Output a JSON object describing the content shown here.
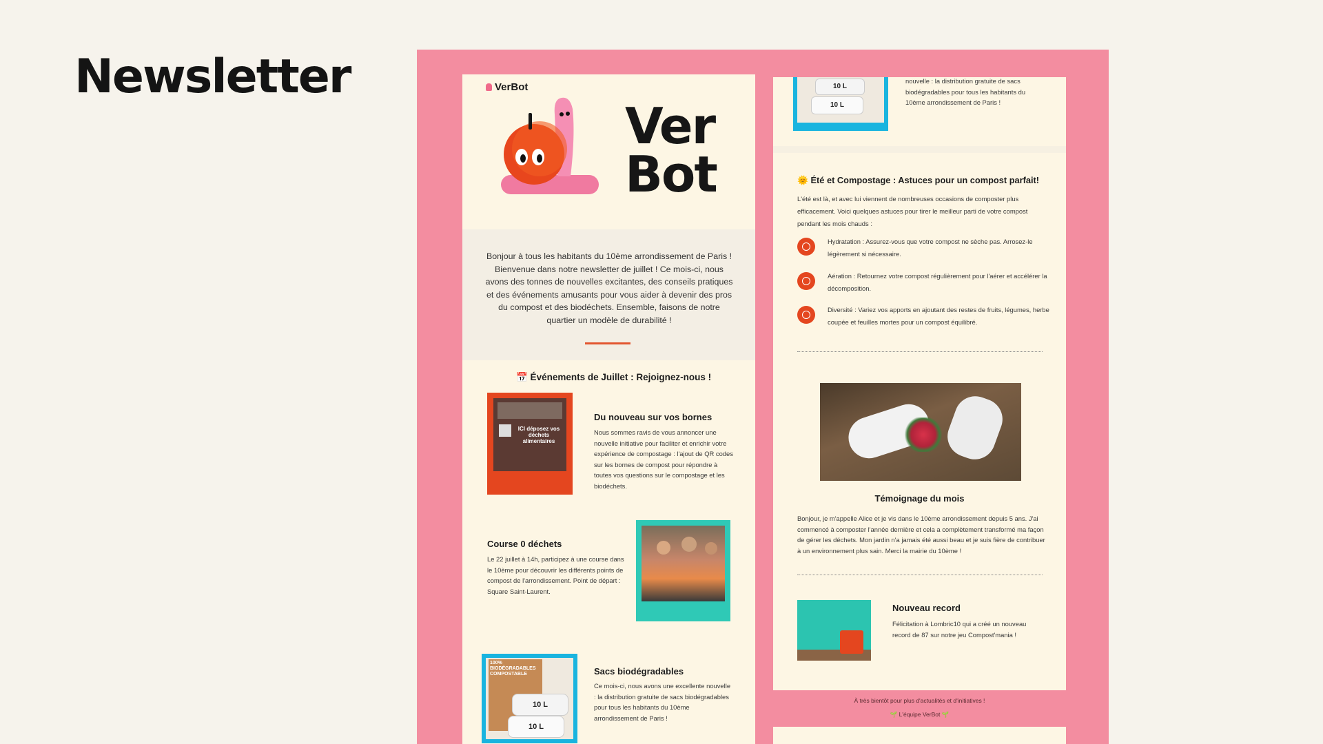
{
  "page": {
    "title": "Newsletter"
  },
  "header": {
    "brand_small": "VerBot",
    "logo_line1": "Ver",
    "logo_line2": "Bot"
  },
  "intro": {
    "text": "Bonjour à tous les habitants du 10ème arrondissement de Paris ! Bienvenue dans notre newsletter de juillet ! Ce mois-ci, nous avons des tonnes de nouvelles excitantes, des conseils pratiques et des événements amusants pour vous aider à devenir des pros du compost et des biodéchets. Ensemble, faisons de notre quartier un modèle de durabilité !"
  },
  "events": {
    "title": "📅 Événements de Juillet : Rejoignez-nous !",
    "items": [
      {
        "title": "Du nouveau sur vos bornes",
        "body": "Nous sommes ravis de vous annoncer une nouvelle initiative pour faciliter et enrichir votre expérience de compostage : l'ajout de QR codes sur les bornes de compost pour répondre à toutes vos questions sur le compostage et les biodéchets.",
        "image_text": "ICI déposez vos déchets alimentaires"
      },
      {
        "title": "Course 0 déchets",
        "body": "Le 22 juillet à 14h, participez à une course dans le 10ème pour découvrir les différents points de compost de l'arrondissement. Point de départ : Square Saint-Laurent."
      },
      {
        "title": "Sacs biodégradables",
        "body": "Ce mois-ci, nous avons une excellente nouvelle : la distribution gratuite de sacs biodégradables pour tous les habitants du 10ème arrondissement de Paris !",
        "image_text": "100% BIODÉGRADABLES COMPOSTABLE",
        "bag_label": "10 L"
      }
    ]
  },
  "right": {
    "top_fragment": "nouvelle : la distribution gratuite de sacs biodégradables pour tous les habitants du 10ème arrondissement de Paris !",
    "bag_label": "10 L",
    "summer": {
      "title": "🌞 Été et Compostage : Astuces pour un compost parfait!",
      "intro": "L'été est là, et avec lui viennent de nombreuses occasions de composter plus efficacement. Voici quelques astuces pour tirer le meilleur parti de votre compost pendant les mois chauds :",
      "tips": [
        "Hydratation : Assurez-vous que votre compost ne sèche pas. Arrosez-le légèrement si nécessaire.",
        "Aération : Retournez votre compost régulièrement pour l'aérer et accélérer la décomposition.",
        "Diversité : Variez vos apports en ajoutant des restes de fruits, légumes, herbe coupée et feuilles mortes pour un compost équilibré."
      ]
    },
    "testimony": {
      "title": "Témoignage du mois",
      "body": "Bonjour, je m'appelle Alice et je vis dans le 10ème arrondissement depuis 5 ans. J'ai commencé à composter l'année dernière et cela a complètement transformé ma façon de gérer les déchets. Mon jardin n'a jamais été aussi beau et je suis fière de contribuer à un environnement plus sain. Merci la mairie du 10ème !"
    },
    "record": {
      "title": "Nouveau record",
      "body": "Félicitation à Lombric10 qui a créé un nouveau record de 87 sur notre jeu Compost'mania !"
    },
    "footer": {
      "line1": "À très bientôt pour plus d'actualités et d'initiatives !",
      "line2": "🌱 L'équipe VerBot 🌱"
    }
  },
  "colors": {
    "pink": "#f38da0",
    "cream": "#fdf6e4",
    "orange": "#e4461f",
    "teal": "#2fc9b6",
    "blue": "#19b4df"
  }
}
